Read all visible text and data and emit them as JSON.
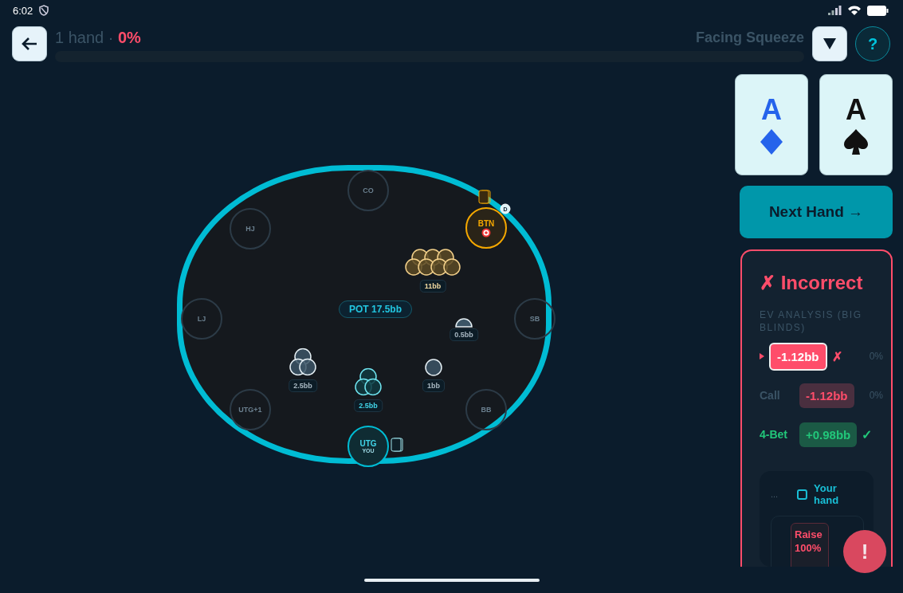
{
  "status_bar": {
    "time": "6:02"
  },
  "header": {
    "hands": "1 hand",
    "separator": "·",
    "accuracy": "0%",
    "progress": {
      "level": 0
    },
    "scenario": "Facing Squeeze",
    "help": "?"
  },
  "table": {
    "pot": "POT 17.5bb",
    "seats": [
      {
        "label": "CO",
        "kind": "idle"
      },
      {
        "label": "HJ",
        "kind": "idle"
      },
      {
        "label": "BTN",
        "kind": "villain",
        "cards": true,
        "dealer": "D",
        "bet": "11bb"
      },
      {
        "label": "LJ",
        "kind": "idle"
      },
      {
        "label": "SB",
        "kind": "idle",
        "bet": "0.5bb"
      },
      {
        "label": "UTG+1",
        "kind": "idle",
        "bet": "2.5bb"
      },
      {
        "label": "BB",
        "kind": "idle",
        "bet": "1bb"
      },
      {
        "label": "UTG",
        "kind": "hero",
        "sub": "YOU",
        "cards": true,
        "bet": "2.5bb"
      }
    ]
  },
  "cards": [
    {
      "rank": "A",
      "kind": "diamond",
      "color": "#2563eb"
    },
    {
      "rank": "A",
      "kind": "spade",
      "color": "#111111"
    }
  ],
  "next_button": "Next Hand →",
  "result": {
    "mark": "✗",
    "verdict": "Incorrect",
    "section": "EV ANALYSIS (BIG BLINDS)",
    "rows": [
      {
        "kind": "chosen",
        "ev": "-1.12bb",
        "mark": "✗",
        "share": "0%"
      },
      {
        "kind": "plain",
        "action": "Call",
        "ev": "-1.12bb",
        "share": "0%"
      },
      {
        "kind": "best",
        "action": "4-Bet",
        "mark": "✓",
        "ev": "+0.98bb"
      }
    ],
    "hand_box": {
      "menu": "...",
      "legend": "Your hand",
      "action": "Raise",
      "share": "100%"
    }
  },
  "alert": "!"
}
